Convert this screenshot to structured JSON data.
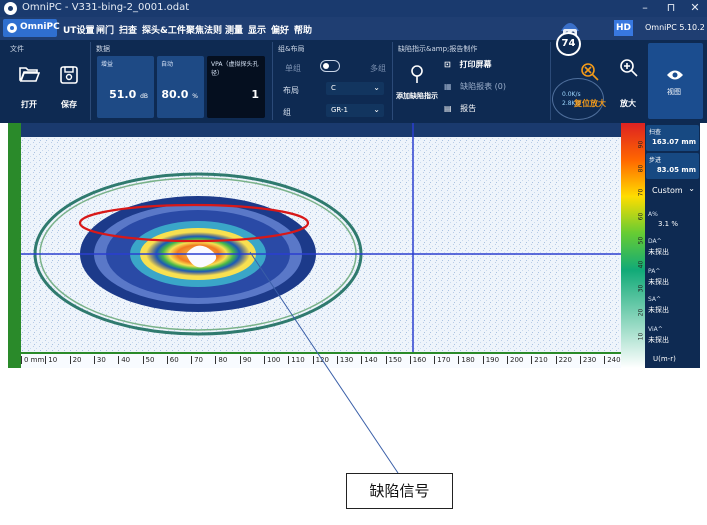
{
  "window": {
    "title": "OmniPC - V331-bing-2_0001.odat",
    "min": "–",
    "max": "⊓",
    "close": "✕"
  },
  "menu": {
    "app": "OmniPC",
    "items": [
      "UT设置",
      "闸门",
      "扫查",
      "探头&工件",
      "聚焦法则",
      "测量",
      "显示",
      "偏好",
      "帮助"
    ],
    "hd": "HD",
    "version": "OmniPC 5.10.2"
  },
  "ribbon": {
    "file": {
      "group": "文件",
      "open": "打开",
      "save": "保存"
    },
    "data": {
      "group": "数据",
      "gain_label": "增益",
      "gain_value": "51.0",
      "gain_unit": "dB",
      "auto_label": "自动",
      "auto_value": "80.0",
      "auto_unit": "%",
      "vpa_label": "VPA（虚拟探头孔径）",
      "vpa_value": "1"
    },
    "layout": {
      "group": "组&布局",
      "single": "单组",
      "multi": "多组",
      "layout_label": "布局",
      "layout_value": "C",
      "group_label": "组",
      "group_value": "GR-1"
    },
    "defect": {
      "group": "缺陷指示&amp;报告制作",
      "add": "添加缺陷指示",
      "print": "打印屏幕",
      "table": "缺陷报表 (0)",
      "report": "报告"
    },
    "gauge_value": "74",
    "speeds": [
      "0.0K/s",
      "2.8K/s"
    ],
    "reset_zoom": "复位放大",
    "zoom": "放大",
    "view": "视图"
  },
  "right_panel": {
    "scan_label": "扫查",
    "scan_value": "163.07",
    "scan_unit": "mm",
    "step_label": "步进",
    "step_value": "83.05",
    "step_unit": "mm",
    "custom": "Custom",
    "a_label": "A%",
    "a_value": "3.1",
    "a_unit": "%",
    "da_label": "DA^",
    "da_value": "未探出",
    "pa_label": "PA^",
    "pa_value": "未探出",
    "sa_label": "SA^",
    "sa_value": "未探出",
    "via_label": "ViA^",
    "via_value": "未探出",
    "unit": "U(m-r)"
  },
  "ruler": {
    "ticks": [
      "0 mm",
      "10",
      "20",
      "30",
      "40",
      "50",
      "60",
      "70",
      "80",
      "90",
      "100",
      "110",
      "120",
      "130",
      "140",
      "150",
      "160",
      "170",
      "180",
      "190",
      "200",
      "210",
      "220",
      "230",
      "240"
    ]
  },
  "colorbar": {
    "ticks": [
      "90",
      "80",
      "70",
      "60",
      "50",
      "40",
      "30",
      "20",
      "10"
    ]
  },
  "annotation": {
    "label": "缺陷信号"
  },
  "colors": {
    "ribbon": "#0e2a52",
    "menu": "#1f3e72",
    "cursor": "#2b3ed0",
    "highlight": "#d81818"
  }
}
